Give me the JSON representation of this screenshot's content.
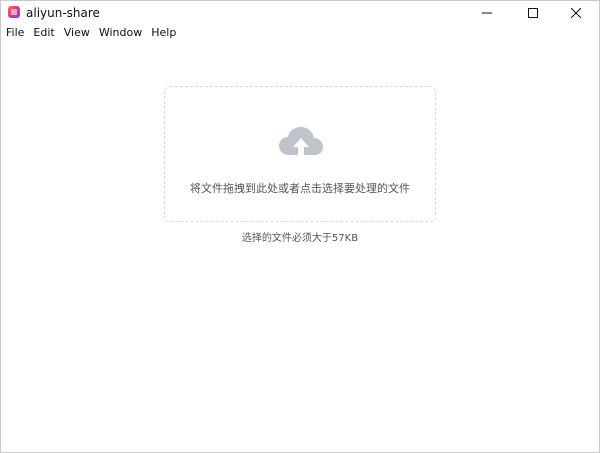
{
  "window": {
    "title": "aliyun-share"
  },
  "menu": {
    "items": [
      "File",
      "Edit",
      "View",
      "Window",
      "Help"
    ]
  },
  "dropzone": {
    "icon": "cloud-upload-icon",
    "text": "将文件拖拽到此处或者点击选择要处理的文件"
  },
  "hint": {
    "text": "选择的文件必须大于57KB"
  },
  "colors": {
    "icon_gray": "#bfc4cc",
    "dashed_border": "#d8d8d8",
    "app_icon_start": "#ff6a3d",
    "app_icon_end": "#7b3fe4"
  }
}
